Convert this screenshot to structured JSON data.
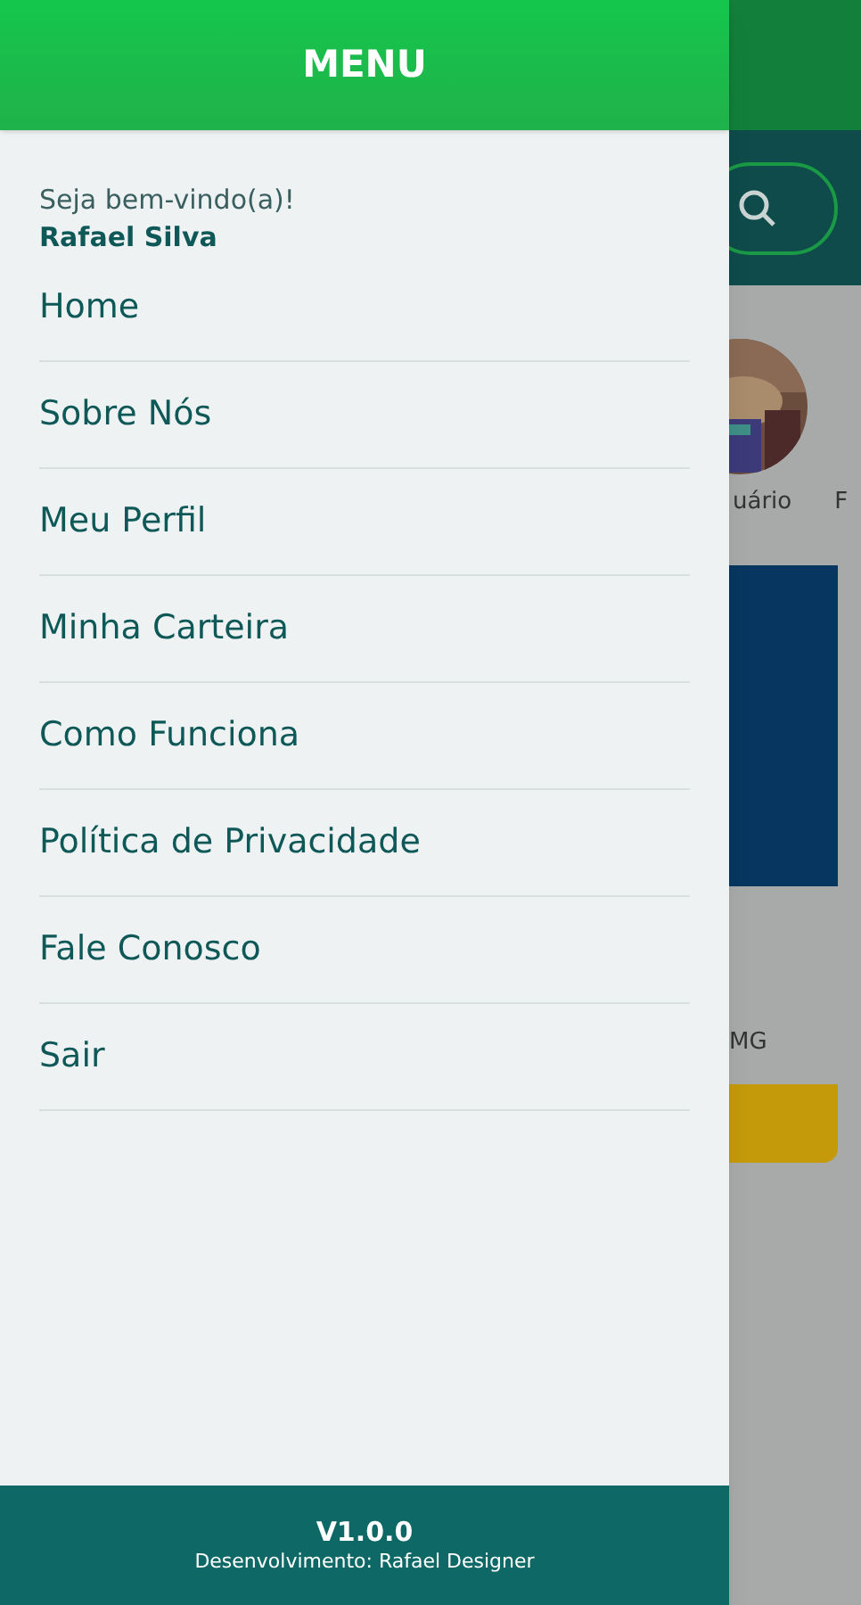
{
  "drawer": {
    "title": "MENU",
    "greeting": "Seja bem-vindo(a)!",
    "user_name": "Rafael Silva",
    "items": [
      {
        "label": "Home"
      },
      {
        "label": "Sobre Nós"
      },
      {
        "label": "Meu Perfil"
      },
      {
        "label": "Minha Carteira"
      },
      {
        "label": "Como Funciona"
      },
      {
        "label": "Política de Privacidade"
      },
      {
        "label": "Fale Conosco"
      },
      {
        "label": "Sair"
      }
    ],
    "footer": {
      "version": "V1.0.0",
      "credit": "Desenvolvimento: Rafael Designer"
    }
  },
  "background": {
    "category_label": "uário",
    "next_label": "F",
    "card_text": "MG"
  }
}
